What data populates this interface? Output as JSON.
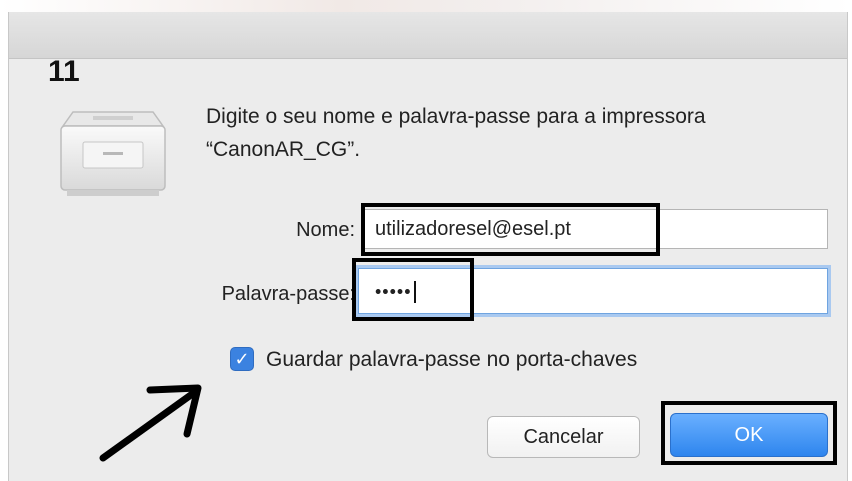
{
  "annotation": {
    "step_number": "11"
  },
  "dialog": {
    "prompt": "Digite o seu nome e palavra-passe para a impressora “CanonAR_CG”.",
    "name_label": "Nome:",
    "name_value": "utilizadoresel@esel.pt",
    "password_label": "Palavra-passe:",
    "password_masked": "•••••",
    "remember_label": "Guardar palavra-passe no porta-chaves",
    "remember_checked": true,
    "cancel_label": "Cancelar",
    "ok_label": "OK"
  },
  "icons": {
    "printer": "printer-icon",
    "checkbox": "checkmark-icon",
    "arrow": "hand-drawn-arrow-icon"
  },
  "colors": {
    "accent": "#3b82e0",
    "ok_button": "#2e85ee",
    "annotation": "#000000",
    "dialog_bg": "#ececec"
  }
}
